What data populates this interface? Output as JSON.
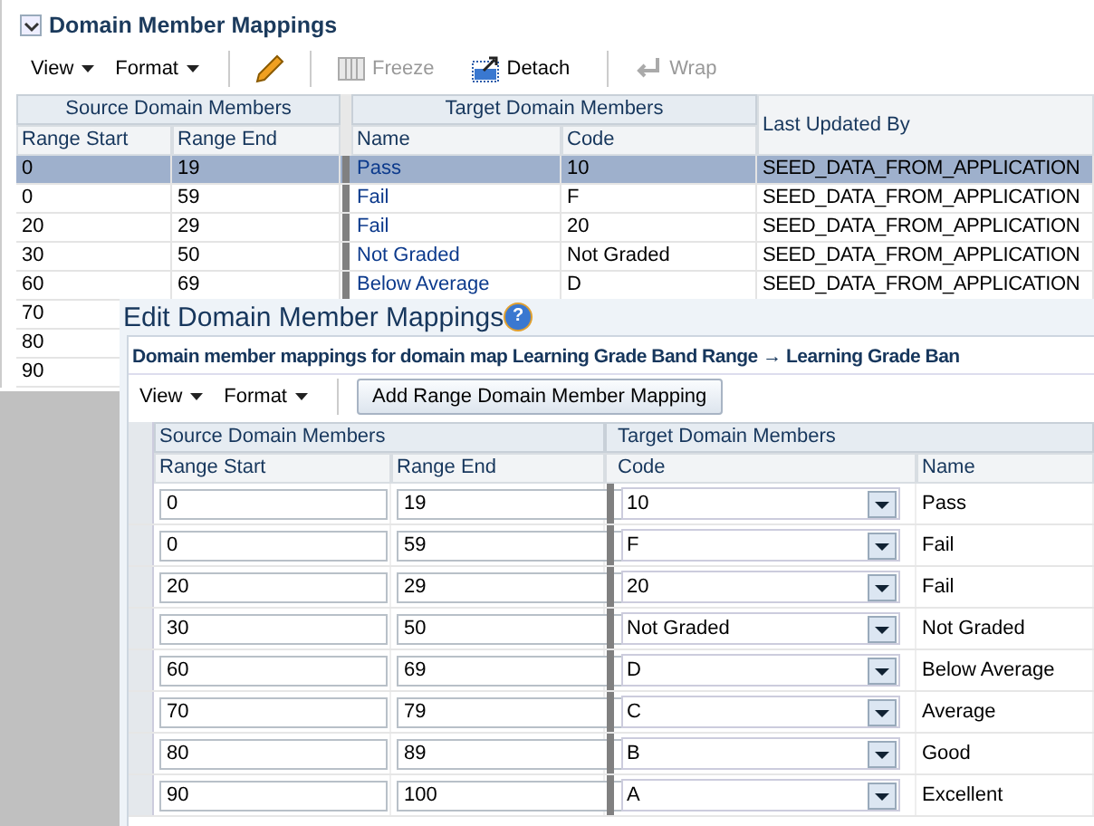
{
  "section": {
    "title": "Domain Member Mappings",
    "expanded": true
  },
  "toolbar": {
    "menus": [
      "View",
      "Format"
    ],
    "buttons": [
      {
        "kind": "freeze",
        "label": "Freeze",
        "disabled": true
      },
      {
        "kind": "detach",
        "label": "Detach",
        "disabled": false
      },
      {
        "kind": "wrap",
        "label": "Wrap",
        "disabled": true
      }
    ]
  },
  "table": {
    "groups": [
      "Source Domain Members",
      "Target Domain Members"
    ],
    "columns": [
      "Range Start",
      "Range End",
      "Name",
      "Code",
      "Last Updated By"
    ],
    "rows": [
      {
        "range_start": "0",
        "range_end": "19",
        "name": "Pass",
        "code": "10",
        "last_updated_by": "SEED_DATA_FROM_APPLICATION",
        "selected": true
      },
      {
        "range_start": "0",
        "range_end": "59",
        "name": "Fail",
        "code": "F",
        "last_updated_by": "SEED_DATA_FROM_APPLICATION",
        "selected": false
      },
      {
        "range_start": "20",
        "range_end": "29",
        "name": "Fail",
        "code": "20",
        "last_updated_by": "SEED_DATA_FROM_APPLICATION",
        "selected": false
      },
      {
        "range_start": "30",
        "range_end": "50",
        "name": "Not Graded",
        "code": "Not Graded",
        "last_updated_by": "SEED_DATA_FROM_APPLICATION",
        "selected": false
      },
      {
        "range_start": "60",
        "range_end": "69",
        "name": "Below Average",
        "code": "D",
        "last_updated_by": "SEED_DATA_FROM_APPLICATION",
        "selected": false
      },
      {
        "range_start": "70",
        "selected": false
      },
      {
        "range_start": "80",
        "selected": false
      },
      {
        "range_start": "90",
        "selected": false
      }
    ]
  },
  "dialog": {
    "title": "Edit Domain Member Mappings",
    "help_icon": "?",
    "subtitle": "Domain member mappings for domain map Learning Grade Band Range → Learning Grade Ban",
    "menus": [
      "View",
      "Format"
    ],
    "add_button": "Add Range Domain Member Mapping",
    "table": {
      "groups": [
        "Source Domain Members",
        "Target Domain Members"
      ],
      "columns": [
        "Range Start",
        "Range End",
        "Code",
        "Name"
      ],
      "rows": [
        {
          "range_start": "0",
          "range_end": "19",
          "code": "10",
          "name": "Pass"
        },
        {
          "range_start": "0",
          "range_end": "59",
          "code": "F",
          "name": "Fail"
        },
        {
          "range_start": "20",
          "range_end": "29",
          "code": "20",
          "name": "Fail"
        },
        {
          "range_start": "30",
          "range_end": "50",
          "code": "Not Graded",
          "name": "Not Graded"
        },
        {
          "range_start": "60",
          "range_end": "69",
          "code": "D",
          "name": "Below Average"
        },
        {
          "range_start": "70",
          "range_end": "79",
          "code": "C",
          "name": "Average"
        },
        {
          "range_start": "80",
          "range_end": "89",
          "code": "B",
          "name": "Good"
        },
        {
          "range_start": "90",
          "range_end": "100",
          "code": "A",
          "name": "Excellent"
        }
      ]
    }
  }
}
